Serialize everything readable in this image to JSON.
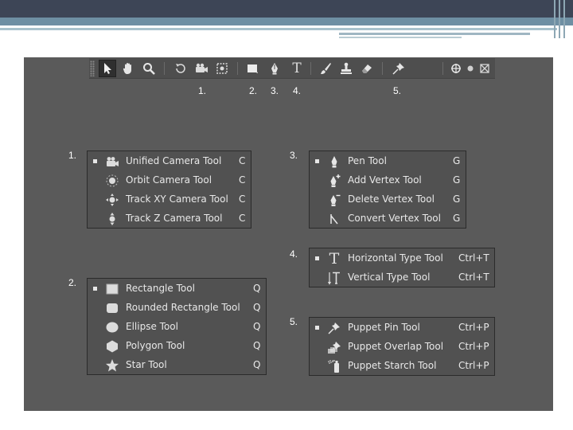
{
  "toolbar": {
    "tools": [
      {
        "name": "selection-tool-button",
        "icon": "arrow-icon",
        "selected": true
      },
      {
        "name": "hand-tool-button",
        "icon": "hand-icon"
      },
      {
        "name": "zoom-tool-button",
        "icon": "magnifier-icon"
      },
      {
        "name": "rotation-tool-button",
        "icon": "rotate-icon"
      },
      {
        "name": "camera-tool-button",
        "icon": "camera-icon"
      },
      {
        "name": "pan-behind-tool-button",
        "icon": "pan-behind-icon"
      },
      {
        "name": "shape-tool-button",
        "icon": "rectangle-icon"
      },
      {
        "name": "pen-tool-button",
        "icon": "pen-icon"
      },
      {
        "name": "type-tool-button",
        "icon": "type-icon"
      },
      {
        "name": "brush-tool-button",
        "icon": "brush-icon"
      },
      {
        "name": "clone-stamp-tool-button",
        "icon": "stamp-icon"
      },
      {
        "name": "eraser-tool-button",
        "icon": "eraser-icon"
      },
      {
        "name": "puppet-tool-button",
        "icon": "pin-icon"
      }
    ],
    "numbers": [
      "1.",
      "2.",
      "3.",
      "4.",
      "5."
    ]
  },
  "groups": [
    {
      "number": "1.",
      "items": [
        {
          "label": "Unified Camera Tool",
          "shortcut": "C",
          "icon": "unified-camera-icon",
          "active": true
        },
        {
          "label": "Orbit Camera Tool",
          "shortcut": "C",
          "icon": "orbit-camera-icon"
        },
        {
          "label": "Track XY Camera Tool",
          "shortcut": "C",
          "icon": "track-xy-camera-icon"
        },
        {
          "label": "Track Z Camera Tool",
          "shortcut": "C",
          "icon": "track-z-camera-icon"
        }
      ]
    },
    {
      "number": "2.",
      "items": [
        {
          "label": "Rectangle Tool",
          "shortcut": "Q",
          "icon": "rectangle-icon",
          "active": true
        },
        {
          "label": "Rounded Rectangle Tool",
          "shortcut": "Q",
          "icon": "rounded-rectangle-icon"
        },
        {
          "label": "Ellipse Tool",
          "shortcut": "Q",
          "icon": "ellipse-icon"
        },
        {
          "label": "Polygon Tool",
          "shortcut": "Q",
          "icon": "polygon-icon"
        },
        {
          "label": "Star Tool",
          "shortcut": "Q",
          "icon": "star-icon"
        }
      ]
    },
    {
      "number": "3.",
      "items": [
        {
          "label": "Pen Tool",
          "shortcut": "G",
          "icon": "pen-icon",
          "active": true
        },
        {
          "label": "Add Vertex Tool",
          "shortcut": "G",
          "icon": "add-vertex-icon"
        },
        {
          "label": "Delete Vertex Tool",
          "shortcut": "G",
          "icon": "delete-vertex-icon"
        },
        {
          "label": "Convert Vertex Tool",
          "shortcut": "G",
          "icon": "convert-vertex-icon"
        }
      ]
    },
    {
      "number": "4.",
      "items": [
        {
          "label": "Horizontal Type Tool",
          "shortcut": "Ctrl+T",
          "icon": "horizontal-type-icon",
          "active": true
        },
        {
          "label": "Vertical Type Tool",
          "shortcut": "Ctrl+T",
          "icon": "vertical-type-icon"
        }
      ]
    },
    {
      "number": "5.",
      "items": [
        {
          "label": "Puppet Pin Tool",
          "shortcut": "Ctrl+P",
          "icon": "puppet-pin-icon",
          "active": true
        },
        {
          "label": "Puppet Overlap Tool",
          "shortcut": "Ctrl+P",
          "icon": "puppet-overlap-icon"
        },
        {
          "label": "Puppet Starch Tool",
          "shortcut": "Ctrl+P",
          "icon": "puppet-starch-icon"
        }
      ]
    }
  ],
  "colors": {
    "panel": "#5a5a5a",
    "menu_bg": "#515151",
    "text": "#e8e8e8",
    "slide_header": "#3d4556",
    "slide_stripe": "#6e8fa3"
  }
}
